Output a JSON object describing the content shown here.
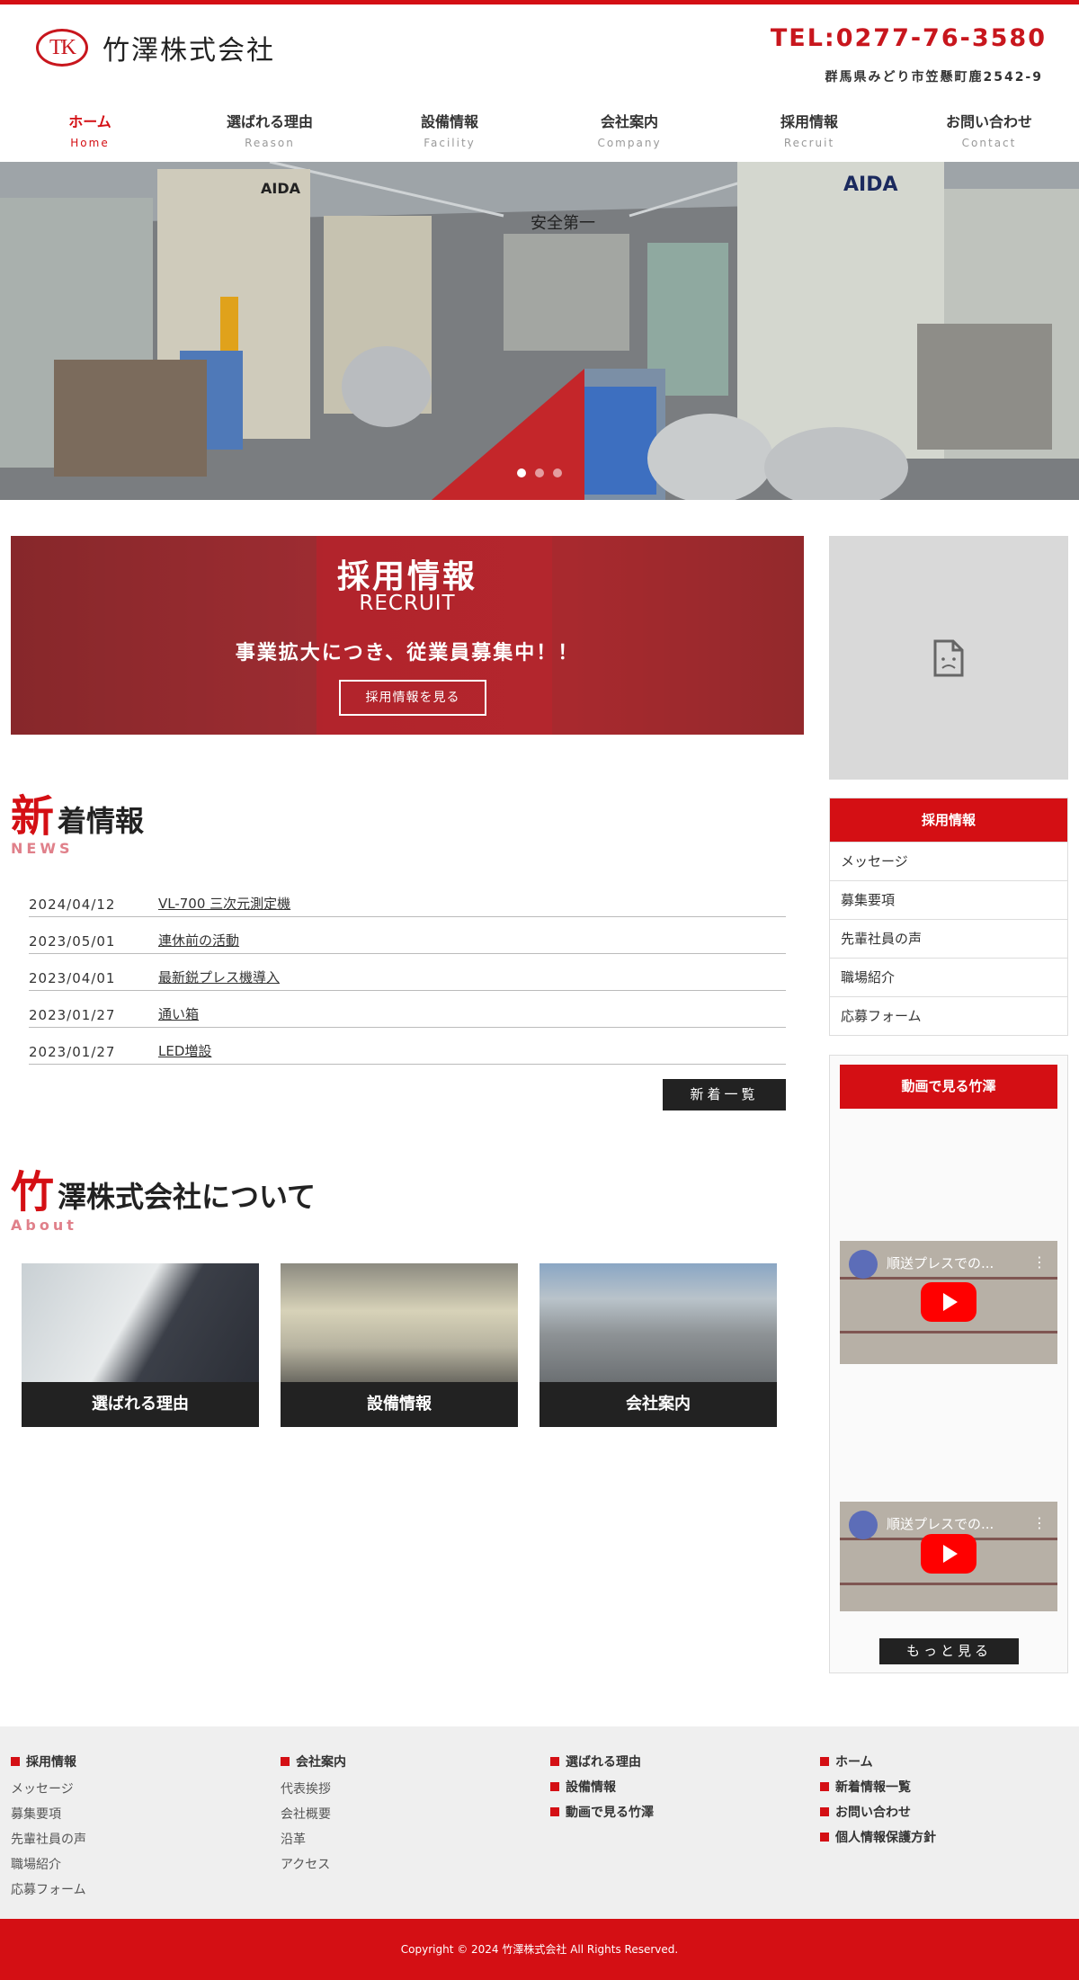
{
  "brand": {
    "logo_mark": "TK",
    "company_name": "竹澤株式会社",
    "tel": "TEL:0277-76-3580",
    "address": "群馬県みどり市笠懸町鹿2542-9",
    "accent_color": "#d40f14"
  },
  "nav": [
    {
      "ja": "ホーム",
      "en": "Home"
    },
    {
      "ja": "選ばれる理由",
      "en": "Reason"
    },
    {
      "ja": "設備情報",
      "en": "Facility"
    },
    {
      "ja": "会社案内",
      "en": "Company"
    },
    {
      "ja": "採用情報",
      "en": "Recruit"
    },
    {
      "ja": "お問い合わせ",
      "en": "Contact"
    }
  ],
  "hero": {
    "sign_left": "AIDA",
    "sign_right": "AIDA",
    "sign_center": "安全第一",
    "slide_count": 3,
    "active_slide": 1
  },
  "recruit_banner": {
    "title": "採用情報",
    "subtitle": "RECRUIT",
    "catch": "事業拡大につき、従業員募集中！！",
    "button": "採用情報を見る"
  },
  "side_media": {
    "icon": "broken-image-icon"
  },
  "side_menu": {
    "head": "採用情報",
    "items": [
      "メッセージ",
      "募集要項",
      "先輩社員の声",
      "職場紹介",
      "応募フォーム"
    ]
  },
  "videos": {
    "head": "動画で見る竹澤",
    "items": [
      {
        "title": "順送プレスでの..."
      },
      {
        "title": "順送プレスでの..."
      }
    ],
    "more": "もっと見る"
  },
  "news": {
    "title_first": "新",
    "title_rest": "着情報",
    "title_en": "NEWS",
    "items": [
      {
        "date": "2024/04/12",
        "title": "VL-700 三次元測定機"
      },
      {
        "date": "2023/05/01",
        "title": "連休前の活動"
      },
      {
        "date": "2023/04/01",
        "title": "最新鋭プレス機導入"
      },
      {
        "date": "2023/01/27",
        "title": "通い箱"
      },
      {
        "date": "2023/01/27",
        "title": "LED増設"
      }
    ],
    "all_button": "新着一覧"
  },
  "about": {
    "title_first": "竹",
    "title_rest": "澤株式会社について",
    "title_en": "About",
    "cards": [
      {
        "label": "選ばれる理由"
      },
      {
        "label": "設備情報"
      },
      {
        "label": "会社案内"
      }
    ]
  },
  "footer": {
    "col1": {
      "head": "採用情報",
      "items": [
        "メッセージ",
        "募集要項",
        "先輩社員の声",
        "職場紹介",
        "応募フォーム"
      ]
    },
    "col2": {
      "head": "会社案内",
      "items": [
        "代表挨拶",
        "会社概要",
        "沿革",
        "アクセス"
      ]
    },
    "col3": {
      "heads": [
        "選ばれる理由",
        "設備情報",
        "動画で見る竹澤"
      ]
    },
    "col4": {
      "heads": [
        "ホーム",
        "新着情報一覧",
        "お問い合わせ",
        "個人情報保護方針"
      ]
    },
    "copyright": "Copyright © 2024 竹澤株式会社 All Rights Reserved."
  }
}
